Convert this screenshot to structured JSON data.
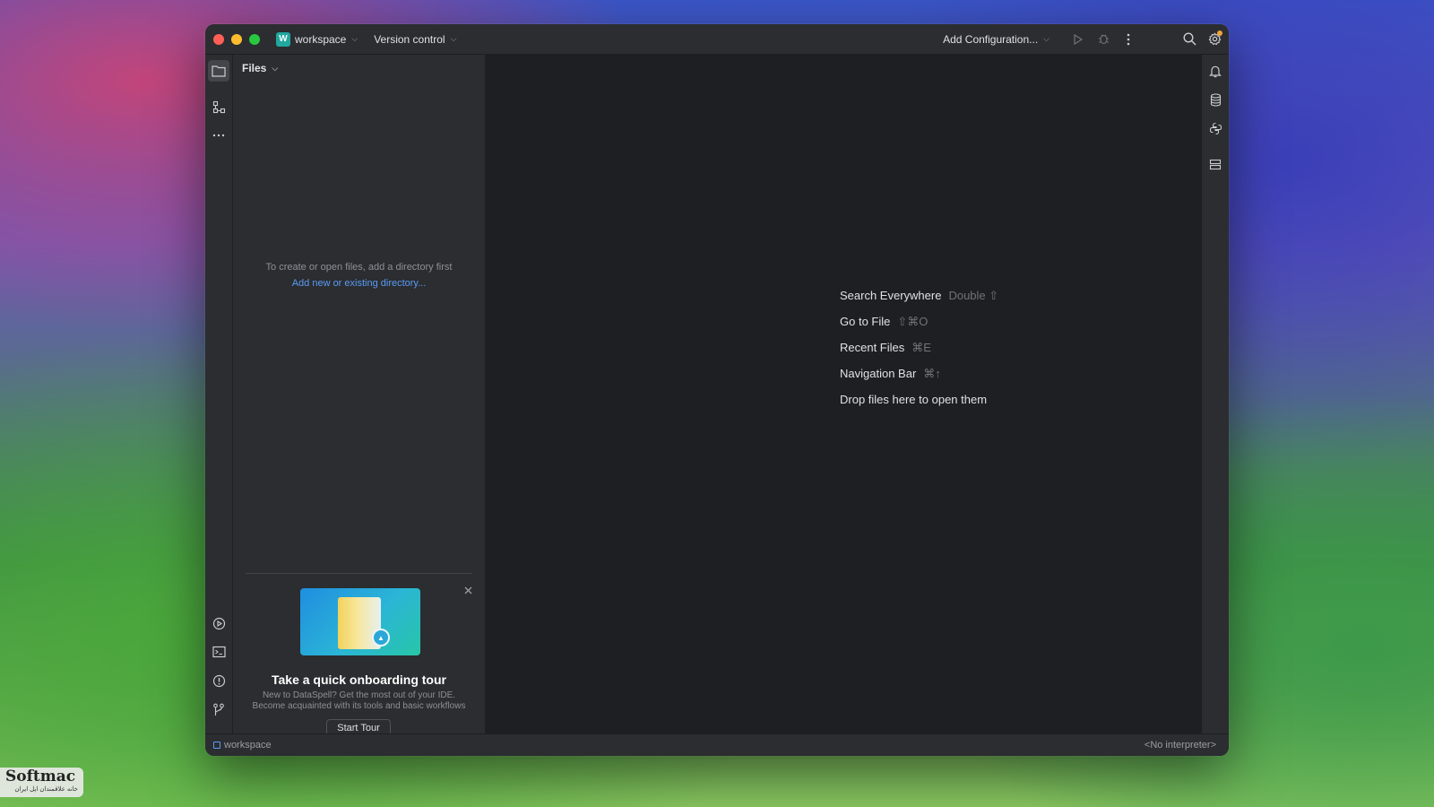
{
  "titlebar": {
    "project_badge": "W",
    "project_name": "workspace",
    "version_control": "Version control",
    "add_configuration": "Add Configuration..."
  },
  "files_panel": {
    "header": "Files",
    "empty_hint": "To create or open files, add a directory first",
    "empty_link": "Add new or existing directory..."
  },
  "editor": {
    "hints": [
      {
        "label": "Search Everywhere",
        "shortcut": "Double ⇧"
      },
      {
        "label": "Go to File",
        "shortcut": "⇧⌘O"
      },
      {
        "label": "Recent Files",
        "shortcut": "⌘E"
      },
      {
        "label": "Navigation Bar",
        "shortcut": "⌘↑"
      },
      {
        "label": "Drop files here to open them",
        "shortcut": ""
      }
    ]
  },
  "tour": {
    "title": "Take a quick onboarding tour",
    "desc_line1": "New to DataSpell? Get the most out of your IDE.",
    "desc_line2": "Become acquainted with its tools and basic workflows",
    "button": "Start Tour"
  },
  "statusbar": {
    "project": "workspace",
    "interpreter": "<No interpreter>"
  },
  "watermark": {
    "brand": "Softmac",
    "tagline": "خانه علاقمندان اپل ایران"
  },
  "colors": {
    "accent_link": "#5a9bf5",
    "project_badge": "#20a7a0",
    "notification_dot": "#f0a33a"
  }
}
